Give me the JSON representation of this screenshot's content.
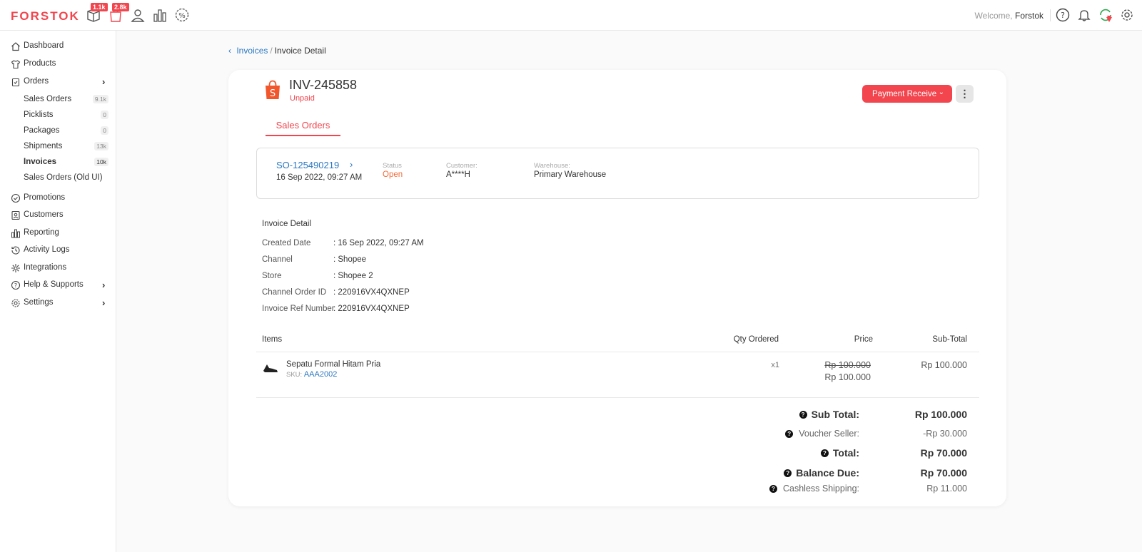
{
  "app": {
    "logo": "FORSTOK",
    "badge_products": "1.1k",
    "badge_orders": "2.8k",
    "welcome_prefix": "Welcome,",
    "welcome_user": "Forstok"
  },
  "sidebar": {
    "items": [
      {
        "label": "Dashboard"
      },
      {
        "label": "Products"
      },
      {
        "label": "Orders"
      },
      {
        "label": "Promotions"
      },
      {
        "label": "Customers"
      },
      {
        "label": "Reporting"
      },
      {
        "label": "Activity Logs"
      },
      {
        "label": "Integrations"
      },
      {
        "label": "Help & Supports"
      },
      {
        "label": "Settings"
      }
    ],
    "orders_sub": [
      {
        "label": "Sales Orders",
        "count": "9.1k"
      },
      {
        "label": "Picklists",
        "count": "0"
      },
      {
        "label": "Packages",
        "count": "0"
      },
      {
        "label": "Shipments",
        "count": "13k"
      },
      {
        "label": "Invoices",
        "count": "10k"
      },
      {
        "label": "Sales Orders (Old UI)",
        "count": ""
      }
    ]
  },
  "breadcrumb": {
    "back": "Invoices",
    "separator": "/",
    "current": "Invoice Detail"
  },
  "invoice": {
    "number": "INV-245858",
    "status": "Unpaid",
    "action_button": "Payment Receive",
    "tab": "Sales Orders"
  },
  "sales_order": {
    "number": "SO-125490219",
    "date": "16 Sep 2022, 09:27 AM",
    "status_label": "Status",
    "status_value": "Open",
    "customer_label": "Customer:",
    "customer_value": "A****H",
    "warehouse_label": "Warehouse:",
    "warehouse_value": "Primary Warehouse"
  },
  "detail": {
    "title": "Invoice Detail",
    "rows": [
      {
        "key": "Created Date",
        "value": ": 16 Sep 2022, 09:27 AM"
      },
      {
        "key": "Channel",
        "value": ": Shopee"
      },
      {
        "key": "Store",
        "value": ": Shopee 2"
      },
      {
        "key": "Channel Order ID",
        "value": ": 220916VX4QXNEP"
      },
      {
        "key": "Invoice Ref Number",
        "value": ": 220916VX4QXNEP"
      }
    ]
  },
  "table": {
    "headers": {
      "items": "Items",
      "qty": "Qty Ordered",
      "price": "Price",
      "subtotal": "Sub-Total"
    },
    "rows": [
      {
        "name": "Sepatu Formal Hitam Pria",
        "sku_label": "SKU:",
        "sku": "AAA2002",
        "qty": "x1",
        "price_original": "Rp 100.000",
        "price": "Rp 100.000",
        "subtotal": "Rp 100.000"
      }
    ]
  },
  "totals": {
    "sub_total_label": "Sub Total:",
    "sub_total": "Rp 100.000",
    "voucher_label": "Voucher Seller:",
    "voucher": "-Rp 30.000",
    "total_label": "Total:",
    "total": "Rp 70.000",
    "balance_label": "Balance Due:",
    "balance": "Rp 70.000",
    "cashless_label": "Cashless Shipping:",
    "cashless": "Rp 11.000"
  },
  "colors": {
    "accent": "#f2454e",
    "link": "#2b78c2",
    "status_open": "#f26b3a"
  },
  "icons": [
    "box-icon",
    "bag-icon",
    "user-icon",
    "chart-icon",
    "percent-icon",
    "help-icon",
    "bell-icon",
    "sync-alert-icon",
    "gear-icon",
    "shopee-icon"
  ]
}
